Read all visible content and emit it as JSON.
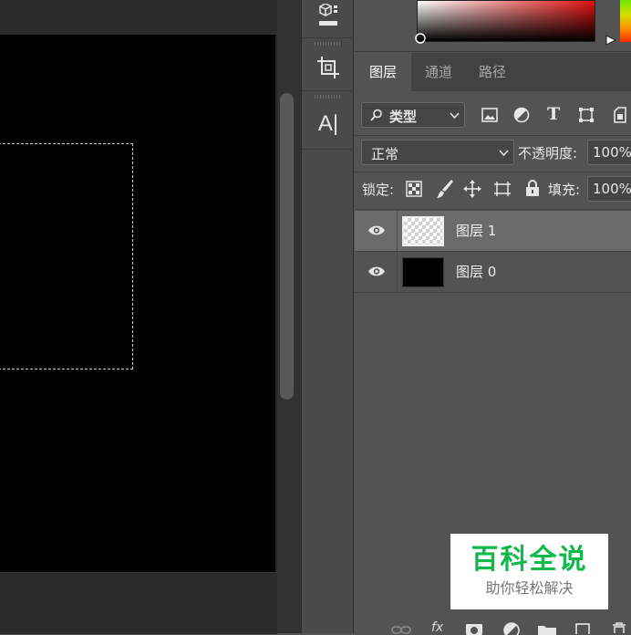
{
  "layers_panel": {
    "tabs": [
      {
        "label": "图层",
        "active": true
      },
      {
        "label": "通道",
        "active": false
      },
      {
        "label": "路径",
        "active": false
      }
    ],
    "filter": {
      "label": "类型",
      "icons": [
        "image-filter-icon",
        "adjustment-filter-icon",
        "type-filter-icon",
        "shape-filter-icon",
        "smart-object-filter-icon"
      ]
    },
    "blend_mode": "正常",
    "opacity_label": "不透明度:",
    "opacity_value": "100%",
    "lock_label": "锁定:",
    "fill_label": "填充:",
    "fill_value": "100%",
    "layers": [
      {
        "name": "图层 1",
        "visible": true,
        "selected": true,
        "thumbnail": "transparent"
      },
      {
        "name": "图层 0",
        "visible": true,
        "selected": false,
        "thumbnail": "black"
      }
    ],
    "bottom_icons": [
      "link-icon",
      "fx-icon",
      "mask-icon",
      "adjustment-icon",
      "folder-icon",
      "new-layer-icon",
      "trash-icon"
    ],
    "bottom_fx_label": "fx"
  },
  "tools": [
    {
      "name": "3d-object-tool"
    },
    {
      "name": "crop-tool"
    },
    {
      "name": "character-panel",
      "label": "A|"
    }
  ],
  "watermark": {
    "title": "百科全说",
    "subtitle": "助你轻松解决"
  },
  "colors": {
    "panel_bg": "#535353",
    "tab_bar_bg": "#424242",
    "canvas_bg": "#000000",
    "selected_layer_bg": "#6b6b6b",
    "watermark_green": "#13b84b"
  }
}
